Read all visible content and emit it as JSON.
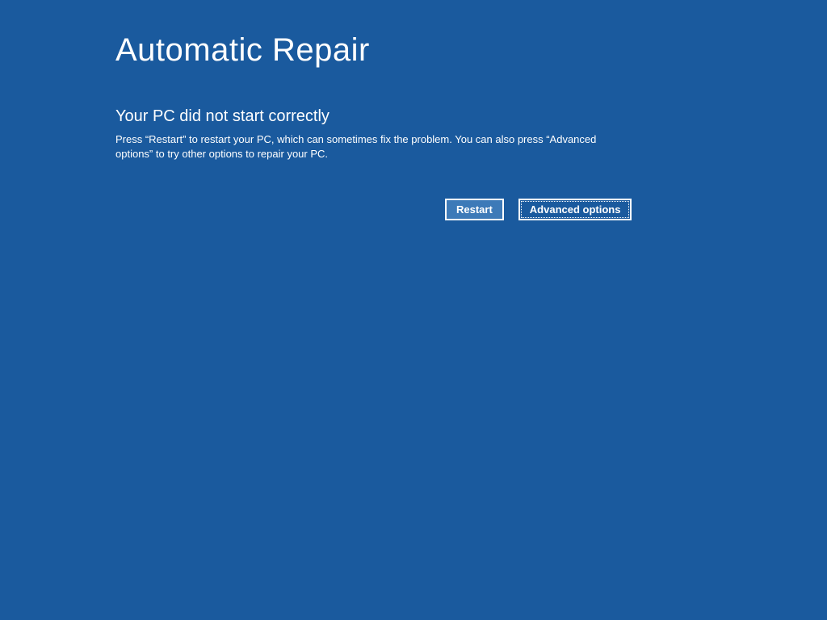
{
  "title": "Automatic Repair",
  "subtitle": "Your PC did not start correctly",
  "description": "Press “Restart” to restart your PC, which can sometimes fix the problem. You can also press “Advanced options” to try other options to repair your PC.",
  "buttons": {
    "restart": "Restart",
    "advanced": "Advanced options"
  }
}
